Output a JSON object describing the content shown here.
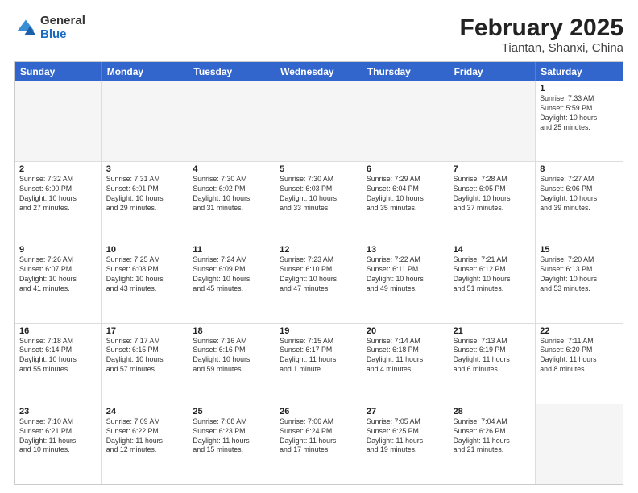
{
  "header": {
    "logo": {
      "general": "General",
      "blue": "Blue"
    },
    "title": "February 2025",
    "subtitle": "Tiantan, Shanxi, China"
  },
  "weekdays": [
    "Sunday",
    "Monday",
    "Tuesday",
    "Wednesday",
    "Thursday",
    "Friday",
    "Saturday"
  ],
  "rows": [
    [
      {
        "day": "",
        "text": "",
        "empty": true
      },
      {
        "day": "",
        "text": "",
        "empty": true
      },
      {
        "day": "",
        "text": "",
        "empty": true
      },
      {
        "day": "",
        "text": "",
        "empty": true
      },
      {
        "day": "",
        "text": "",
        "empty": true
      },
      {
        "day": "",
        "text": "",
        "empty": true
      },
      {
        "day": "1",
        "text": "Sunrise: 7:33 AM\nSunset: 5:59 PM\nDaylight: 10 hours\nand 25 minutes.",
        "empty": false
      }
    ],
    [
      {
        "day": "2",
        "text": "Sunrise: 7:32 AM\nSunset: 6:00 PM\nDaylight: 10 hours\nand 27 minutes.",
        "empty": false
      },
      {
        "day": "3",
        "text": "Sunrise: 7:31 AM\nSunset: 6:01 PM\nDaylight: 10 hours\nand 29 minutes.",
        "empty": false
      },
      {
        "day": "4",
        "text": "Sunrise: 7:30 AM\nSunset: 6:02 PM\nDaylight: 10 hours\nand 31 minutes.",
        "empty": false
      },
      {
        "day": "5",
        "text": "Sunrise: 7:30 AM\nSunset: 6:03 PM\nDaylight: 10 hours\nand 33 minutes.",
        "empty": false
      },
      {
        "day": "6",
        "text": "Sunrise: 7:29 AM\nSunset: 6:04 PM\nDaylight: 10 hours\nand 35 minutes.",
        "empty": false
      },
      {
        "day": "7",
        "text": "Sunrise: 7:28 AM\nSunset: 6:05 PM\nDaylight: 10 hours\nand 37 minutes.",
        "empty": false
      },
      {
        "day": "8",
        "text": "Sunrise: 7:27 AM\nSunset: 6:06 PM\nDaylight: 10 hours\nand 39 minutes.",
        "empty": false
      }
    ],
    [
      {
        "day": "9",
        "text": "Sunrise: 7:26 AM\nSunset: 6:07 PM\nDaylight: 10 hours\nand 41 minutes.",
        "empty": false
      },
      {
        "day": "10",
        "text": "Sunrise: 7:25 AM\nSunset: 6:08 PM\nDaylight: 10 hours\nand 43 minutes.",
        "empty": false
      },
      {
        "day": "11",
        "text": "Sunrise: 7:24 AM\nSunset: 6:09 PM\nDaylight: 10 hours\nand 45 minutes.",
        "empty": false
      },
      {
        "day": "12",
        "text": "Sunrise: 7:23 AM\nSunset: 6:10 PM\nDaylight: 10 hours\nand 47 minutes.",
        "empty": false
      },
      {
        "day": "13",
        "text": "Sunrise: 7:22 AM\nSunset: 6:11 PM\nDaylight: 10 hours\nand 49 minutes.",
        "empty": false
      },
      {
        "day": "14",
        "text": "Sunrise: 7:21 AM\nSunset: 6:12 PM\nDaylight: 10 hours\nand 51 minutes.",
        "empty": false
      },
      {
        "day": "15",
        "text": "Sunrise: 7:20 AM\nSunset: 6:13 PM\nDaylight: 10 hours\nand 53 minutes.",
        "empty": false
      }
    ],
    [
      {
        "day": "16",
        "text": "Sunrise: 7:18 AM\nSunset: 6:14 PM\nDaylight: 10 hours\nand 55 minutes.",
        "empty": false
      },
      {
        "day": "17",
        "text": "Sunrise: 7:17 AM\nSunset: 6:15 PM\nDaylight: 10 hours\nand 57 minutes.",
        "empty": false
      },
      {
        "day": "18",
        "text": "Sunrise: 7:16 AM\nSunset: 6:16 PM\nDaylight: 10 hours\nand 59 minutes.",
        "empty": false
      },
      {
        "day": "19",
        "text": "Sunrise: 7:15 AM\nSunset: 6:17 PM\nDaylight: 11 hours\nand 1 minute.",
        "empty": false
      },
      {
        "day": "20",
        "text": "Sunrise: 7:14 AM\nSunset: 6:18 PM\nDaylight: 11 hours\nand 4 minutes.",
        "empty": false
      },
      {
        "day": "21",
        "text": "Sunrise: 7:13 AM\nSunset: 6:19 PM\nDaylight: 11 hours\nand 6 minutes.",
        "empty": false
      },
      {
        "day": "22",
        "text": "Sunrise: 7:11 AM\nSunset: 6:20 PM\nDaylight: 11 hours\nand 8 minutes.",
        "empty": false
      }
    ],
    [
      {
        "day": "23",
        "text": "Sunrise: 7:10 AM\nSunset: 6:21 PM\nDaylight: 11 hours\nand 10 minutes.",
        "empty": false
      },
      {
        "day": "24",
        "text": "Sunrise: 7:09 AM\nSunset: 6:22 PM\nDaylight: 11 hours\nand 12 minutes.",
        "empty": false
      },
      {
        "day": "25",
        "text": "Sunrise: 7:08 AM\nSunset: 6:23 PM\nDaylight: 11 hours\nand 15 minutes.",
        "empty": false
      },
      {
        "day": "26",
        "text": "Sunrise: 7:06 AM\nSunset: 6:24 PM\nDaylight: 11 hours\nand 17 minutes.",
        "empty": false
      },
      {
        "day": "27",
        "text": "Sunrise: 7:05 AM\nSunset: 6:25 PM\nDaylight: 11 hours\nand 19 minutes.",
        "empty": false
      },
      {
        "day": "28",
        "text": "Sunrise: 7:04 AM\nSunset: 6:26 PM\nDaylight: 11 hours\nand 21 minutes.",
        "empty": false
      },
      {
        "day": "",
        "text": "",
        "empty": true
      }
    ]
  ]
}
